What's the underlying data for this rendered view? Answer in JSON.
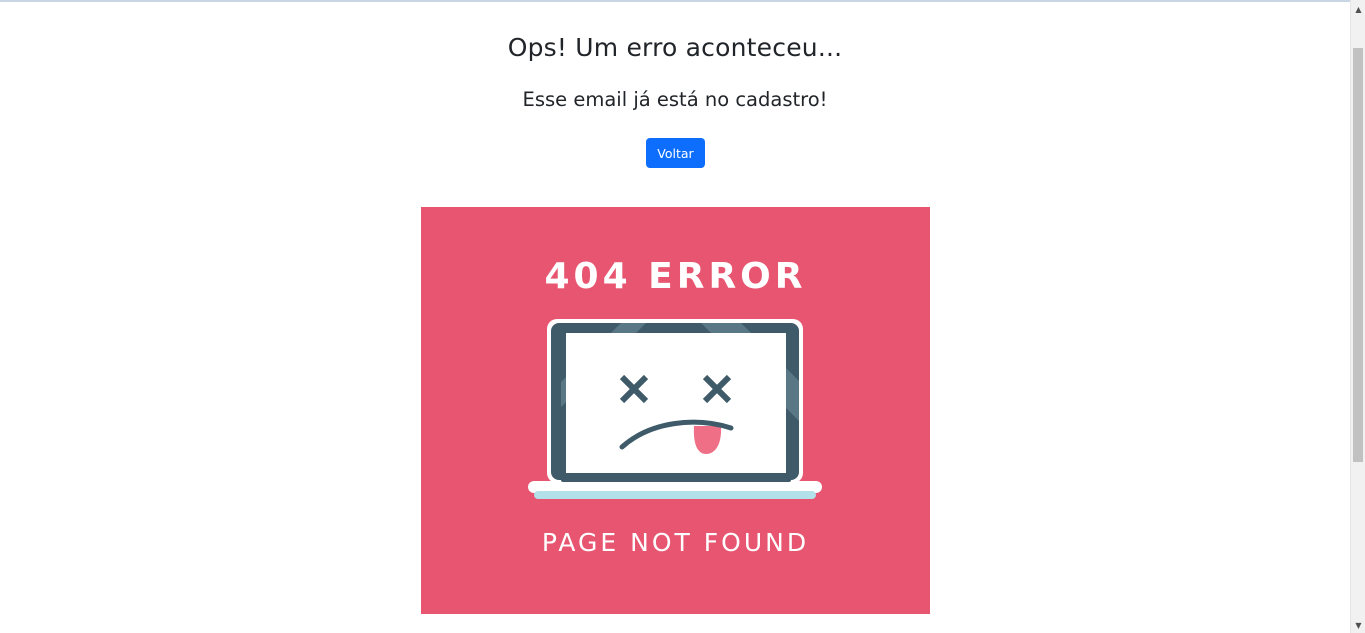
{
  "page": {
    "title": "Ops! Um erro aconteceu...",
    "message": "Esse email já está no cadastro!",
    "back_button_label": "Voltar"
  },
  "error_illustration": {
    "heading": "404 ERROR",
    "caption": "PAGE NOT FOUND",
    "icon": "broken-laptop-icon",
    "colors": {
      "background": "#e85570",
      "laptop_frame": "#3f5b6a",
      "laptop_screen": "#ffffff",
      "tongue": "#ef6f86",
      "keyboard_base": "#b2e1ea"
    }
  },
  "theme": {
    "button_color": "#0d6efd",
    "text_color": "#212529"
  }
}
